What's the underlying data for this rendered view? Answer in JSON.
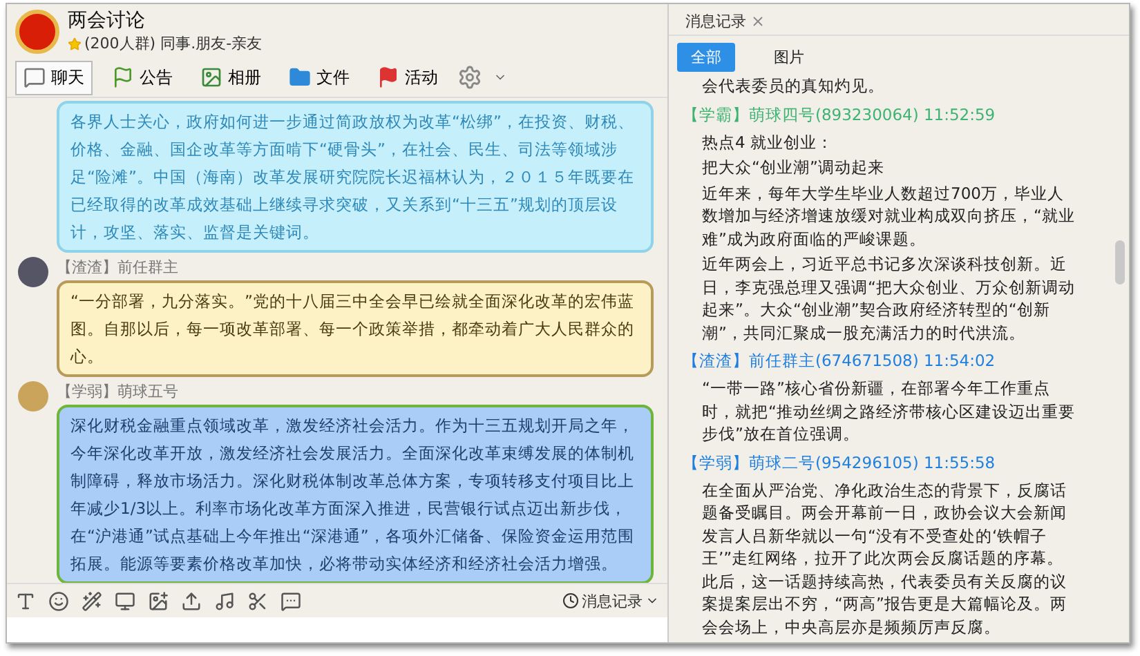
{
  "group": {
    "name": "两会讨论",
    "subtitle": "(200人群) 同事.朋友-亲友"
  },
  "tabs": [
    {
      "label": "聊天",
      "selected": true
    },
    {
      "label": "公告",
      "selected": false
    },
    {
      "label": "相册",
      "selected": false
    },
    {
      "label": "文件",
      "selected": false
    },
    {
      "label": "活动",
      "selected": false
    }
  ],
  "messages": [
    {
      "kind": "cyan",
      "text": "各界人士关心，政府如何进一步通过简政放权为改革“松绑”，在投资、财税、价格、金融、国企改革等方面啃下“硬骨头”，在社会、民生、司法等领域涉足“险滩”。中国（海南）改革发展研究院院长迟福林认为，２０１５年既要在已经取得的改革成效基础上继续寻求突破，又关系到“十三五”规划的顶层设计，攻坚、落实、监督是关键词。"
    },
    {
      "kind": "yellow",
      "sender": "【渣渣】前任群主",
      "text": "“一分部署，九分落实。”党的十八届三中全会早已绘就全面深化改革的宏伟蓝图。自那以后，每一项改革部署、每一个政策举措，都牵动着广大人民群众的心。"
    },
    {
      "kind": "blue",
      "sender": "【学弱】萌球五号",
      "text": "深化财税金融重点领域改革，激发经济社会活力。作为十三五规划开局之年，今年深化改革开放，激发经济社会发展活力。全面深化改革束缚发展的体制机制障碍，释放市场活力。深化财税体制改革总体方案，专项转移支付项目比上年减少1/3以上。利率市场化改革方面深入推进，民营银行试点迈出新步伐，在“沪港通”试点基础上今年推出“深港通”，各项外汇储备、保险资金运用范围拓展。能源等要素价格改革加快，必将带动实体经济和经济社会活力增强。"
    }
  ],
  "history_button": "消息记录",
  "history": {
    "tab": "消息记录",
    "filters": [
      {
        "label": "全部",
        "selected": true
      },
      {
        "label": "图片",
        "selected": false
      }
    ],
    "entries": [
      {
        "body": [
          "会代表委员的真知灼见。"
        ]
      },
      {
        "header": "【学霸】萌球四号(893230064) 11:52:59",
        "color": "#3cb371",
        "body": [
          "热点4 就业创业：",
          "把大众“创业潮”调动起来",
          "近年来，每年大学生毕业人数超过700万，毕业人数增加与经济增速放缓对就业构成双向挤压，“就业难”成为政府面临的严峻课题。",
          "近年两会上，习近平总书记多次深谈科技创新。近日，李克强总理又强调“把大众创业、万众创新调动起来”。大众“创业潮”契合政府经济转型的“创新潮”，共同汇聚成一股充满活力的时代洪流。"
        ]
      },
      {
        "header": "【渣渣】前任群主(674671508) 11:54:02",
        "color": "#1e7fe0",
        "body": [
          "“一带一路”核心省份新疆，在部署今年工作重点时，就把“推动丝绸之路经济带核心区建设迈出重要步伐”放在首位强调。"
        ]
      },
      {
        "header": "【学弱】萌球二号(954296105) 11:55:58",
        "color": "#1e7fe0",
        "body": [
          "在全面从严治党、净化政治生态的背景下，反腐话题备受瞩目。两会开幕前一日，政协会议大会新闻发言人吕新华就以一句“没有不受查处的‘铁帽子王’”走红网络，拉开了此次两会反腐话题的序幕。此后，这一话题持续高热，代表委员有关反腐的议案提案层出不穷，“两高”报告更是大篇幅论及。两会会场上，中央高层亦是频频厉声反腐。"
        ]
      }
    ]
  }
}
